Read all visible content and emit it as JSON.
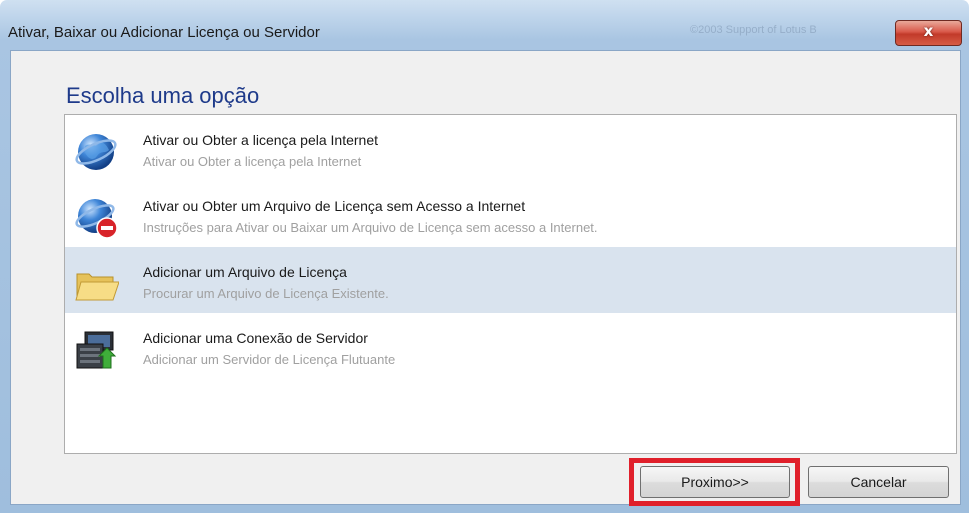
{
  "window": {
    "title": "Ativar, Baixar ou Adicionar Licença ou Servidor",
    "background_text": "©2003 Support of Lotus B",
    "close_glyph": "x"
  },
  "heading": "Escolha uma opção",
  "options": [
    {
      "title": "Ativar ou Obter a licença pela Internet",
      "description": "Ativar ou Obter a licença pela Internet",
      "icon": "globe-icon",
      "selected": false
    },
    {
      "title": "Ativar ou Obter um Arquivo de Licença sem Acesso a Internet",
      "description": "Instruções para Ativar ou Baixar um Arquivo de Licença sem acesso a Internet.",
      "icon": "globe-no-entry-icon",
      "selected": false
    },
    {
      "title": "Adicionar um Arquivo de Licença",
      "description": "Procurar um Arquivo de Licença Existente.",
      "icon": "folder-icon",
      "selected": true
    },
    {
      "title": "Adicionar uma Conexão de Servidor",
      "description": "Adicionar um Servidor de Licença Flutuante",
      "icon": "server-connection-icon",
      "selected": false
    }
  ],
  "buttons": {
    "next": "Proximo>>",
    "cancel": "Cancelar"
  },
  "colors": {
    "heading": "#1e3a8a",
    "selected_row": "#d9e3ee",
    "highlight": "#e0202b"
  }
}
